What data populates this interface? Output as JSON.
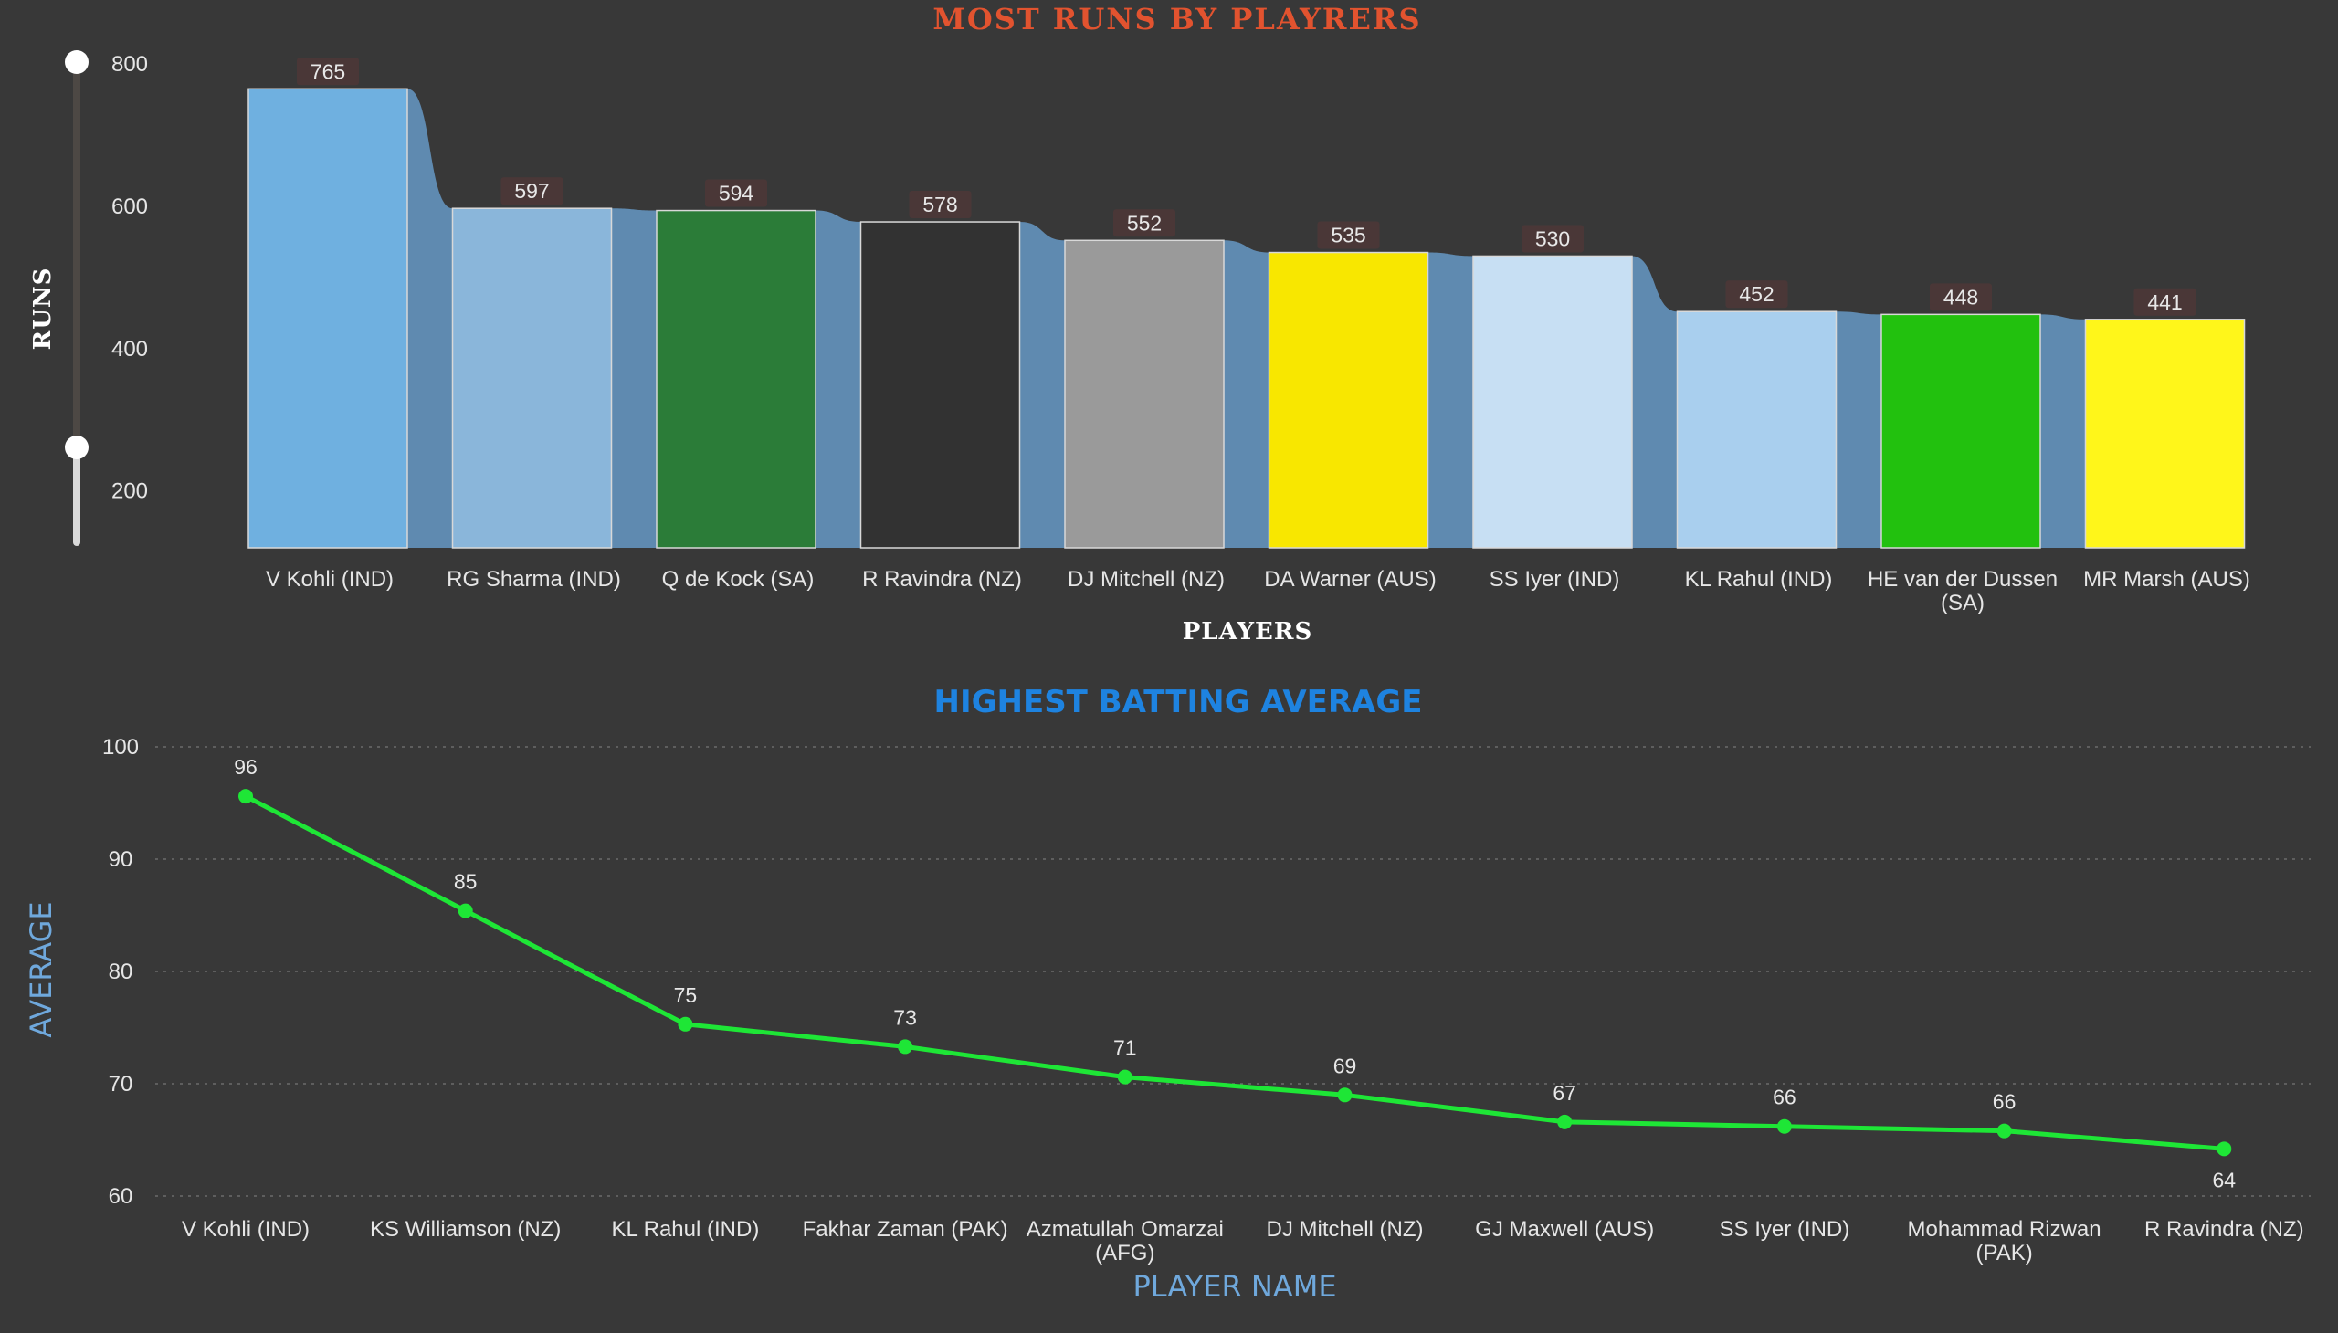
{
  "chart_data": [
    {
      "type": "bar",
      "title": "MOST RUNS BY PLAYRERS",
      "xlabel": "PLAYERS",
      "ylabel": "RUNS",
      "ylim": [
        120,
        800
      ],
      "yticks": [
        200,
        400,
        600,
        800
      ],
      "categories": [
        "V Kohli (IND)",
        "RG Sharma (IND)",
        "Q de Kock (SA)",
        "R Ravindra (NZ)",
        "DJ Mitchell (NZ)",
        "DA Warner (AUS)",
        "SS Iyer (IND)",
        "KL Rahul (IND)",
        "HE van der Dussen (SA)",
        "MR Marsh (AUS)"
      ],
      "values": [
        765,
        597,
        594,
        578,
        552,
        535,
        530,
        452,
        448,
        441
      ],
      "labels": [
        "765",
        "597",
        "594",
        "578",
        "552",
        "535",
        "530",
        "452",
        "448",
        "441"
      ],
      "colors": [
        "#6fb0e0",
        "#8ab6da",
        "#2b7c38",
        "#323232",
        "#9a9a9a",
        "#f8e700",
        "#c7dff3",
        "#a9cfee",
        "#22c10e",
        "#fff61a"
      ],
      "ribbon_color": "#5f8ab0",
      "slider_range": [
        120,
        800
      ]
    },
    {
      "type": "line",
      "title": "HIGHEST BATTING AVERAGE",
      "xlabel": "PLAYER NAME",
      "ylabel": "AVERAGE",
      "ylim": [
        60,
        100
      ],
      "yticks": [
        60,
        70,
        80,
        90,
        100
      ],
      "grid": true,
      "categories": [
        "V Kohli (IND)",
        "KS Williamson (NZ)",
        "KL Rahul (IND)",
        "Fakhar Zaman (PAK)",
        "Azmatullah Omarzai (AFG)",
        "DJ Mitchell (NZ)",
        "GJ Maxwell (AUS)",
        "SS Iyer (IND)",
        "Mohammad Rizwan (PAK)",
        "R Ravindra (NZ)"
      ],
      "values": [
        95.6,
        85.4,
        75.3,
        73.3,
        70.6,
        69.0,
        66.6,
        66.2,
        65.8,
        64.2
      ],
      "labels": [
        "96",
        "85",
        "75",
        "73",
        "71",
        "69",
        "67",
        "66",
        "66",
        "64"
      ],
      "color": "#1ee636"
    }
  ]
}
